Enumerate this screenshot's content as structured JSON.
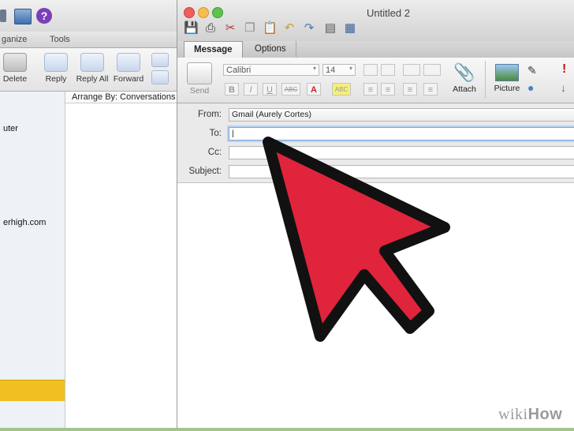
{
  "background_window": {
    "tabs": [
      "ganize",
      "Tools"
    ],
    "ribbon": [
      {
        "label": "Delete",
        "icon": "trash-icon"
      },
      {
        "label": "Reply",
        "icon": "reply-icon"
      },
      {
        "label": "Reply All",
        "icon": "reply-all-icon"
      },
      {
        "label": "Forward",
        "icon": "forward-icon"
      }
    ],
    "list_header": "Arrange By: Conversations",
    "folder_texts": [
      "uter",
      "erhigh.com"
    ]
  },
  "compose_window": {
    "title": "Untitled 2",
    "tabs": [
      {
        "label": "Message"
      },
      {
        "label": "Options"
      }
    ],
    "ribbon": {
      "send_label": "Send",
      "font_name": "Calibri",
      "font_size": "14",
      "attach_label": "Attach",
      "picture_label": "Picture"
    },
    "header": {
      "from_label": "From:",
      "from_value": "Gmail (Aurely Cortes)",
      "to_label": "To:",
      "to_value": "|",
      "cc_label": "Cc:",
      "subject_label": "Subject:"
    }
  },
  "overlay": {
    "pointer_color": "#e0243c",
    "pointer_outline": "#111111"
  },
  "watermark": {
    "prefix": "wiki",
    "suffix": "How"
  }
}
